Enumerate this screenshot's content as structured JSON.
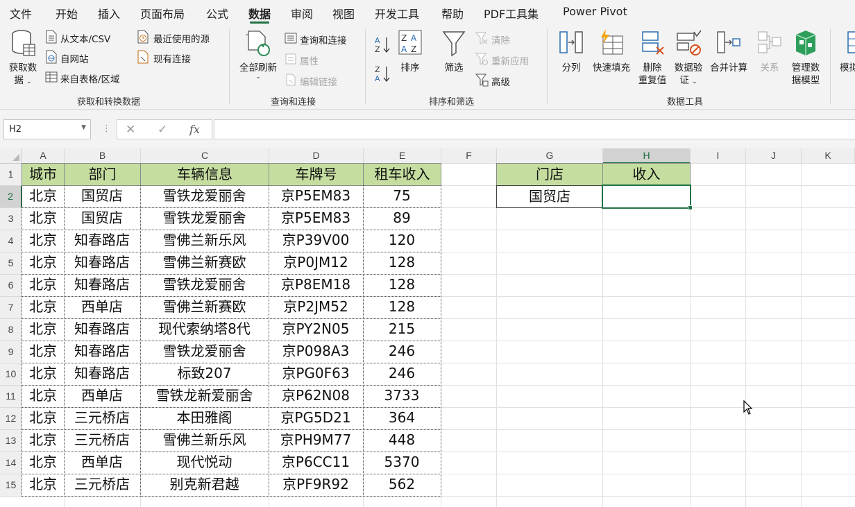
{
  "ribbon_tabs": [
    "文件",
    "开始",
    "插入",
    "页面布局",
    "公式",
    "数据",
    "审阅",
    "视图",
    "开发工具",
    "帮助",
    "PDF工具集",
    "Power Pivot"
  ],
  "active_tab": "数据",
  "groups": {
    "get_transform": {
      "label": "获取和转换数据",
      "get_data_1": "获取数",
      "get_data_2": "据",
      "from_text_csv": "从文本/CSV",
      "from_web": "自网站",
      "from_table_range": "来自表格/区域",
      "recent_sources": "最近使用的源",
      "existing_connections": "现有连接"
    },
    "queries": {
      "label": "查询和连接",
      "refresh_all": "全部刷新",
      "queries_connections": "查询和连接",
      "properties": "属性",
      "edit_links": "编辑链接"
    },
    "sort_filter": {
      "label": "排序和筛选",
      "sort": "排序",
      "filter": "筛选",
      "clear": "清除",
      "reapply": "重新应用",
      "advanced": "高级"
    },
    "data_tools": {
      "label": "数据工具",
      "text_to_columns": "分列",
      "flash_fill": "快速填充",
      "remove_dup_1": "删除",
      "remove_dup_2": "重复值",
      "validation_1": "数据验",
      "validation_2": "证",
      "consolidate": "合并计算",
      "relationships": "关系",
      "manage_model_1": "管理数",
      "manage_model_2": "据模型",
      "whatif_partial": "模拟"
    }
  },
  "formula_bar": {
    "name_box": "H2",
    "fx": "fx",
    "formula": ""
  },
  "columns": [
    "A",
    "B",
    "C",
    "D",
    "E",
    "F",
    "G",
    "H",
    "I",
    "J",
    "K"
  ],
  "selected_column": "H",
  "rows": [
    "1",
    "2",
    "3",
    "4",
    "5",
    "6",
    "7",
    "8",
    "9",
    "10",
    "11",
    "12",
    "13",
    "14",
    "15"
  ],
  "selected_row": "2",
  "table": {
    "headers": [
      "城市",
      "部门",
      "车辆信息",
      "车牌号",
      "租车收入"
    ],
    "rows": [
      [
        "北京",
        "国贸店",
        "雪铁龙爱丽舍",
        "京P5EM83",
        "75"
      ],
      [
        "北京",
        "国贸店",
        "雪铁龙爱丽舍",
        "京P5EM83",
        "89"
      ],
      [
        "北京",
        "知春路店",
        "雪佛兰新乐风",
        "京P39V00",
        "120"
      ],
      [
        "北京",
        "知春路店",
        "雪佛兰新赛欧",
        "京P0JM12",
        "128"
      ],
      [
        "北京",
        "知春路店",
        "雪铁龙爱丽舍",
        "京P8EM18",
        "128"
      ],
      [
        "北京",
        "西单店",
        "雪佛兰新赛欧",
        "京P2JM52",
        "128"
      ],
      [
        "北京",
        "知春路店",
        "现代索纳塔8代",
        "京PY2N05",
        "215"
      ],
      [
        "北京",
        "知春路店",
        "雪铁龙爱丽舍",
        "京P098A3",
        "246"
      ],
      [
        "北京",
        "知春路店",
        "标致207",
        "京PG0F63",
        "246"
      ],
      [
        "北京",
        "西单店",
        "雪铁龙新爱丽舍",
        "京P62N08",
        "3733"
      ],
      [
        "北京",
        "三元桥店",
        "本田雅阁",
        "京PG5D21",
        "364"
      ],
      [
        "北京",
        "三元桥店",
        "雪佛兰新乐风",
        "京PH9M77",
        "448"
      ],
      [
        "北京",
        "西单店",
        "现代悦动",
        "京P6CC11",
        "5370"
      ],
      [
        "北京",
        "三元桥店",
        "别克新君越",
        "京PF9R92",
        "562"
      ]
    ]
  },
  "lookup": {
    "headers": [
      "门店",
      "收入"
    ],
    "store": "国贸店",
    "income": ""
  },
  "colors": {
    "accent": "#217346",
    "header_fill": "#c5dea0",
    "ribbon_bg": "#f3f3f3"
  }
}
